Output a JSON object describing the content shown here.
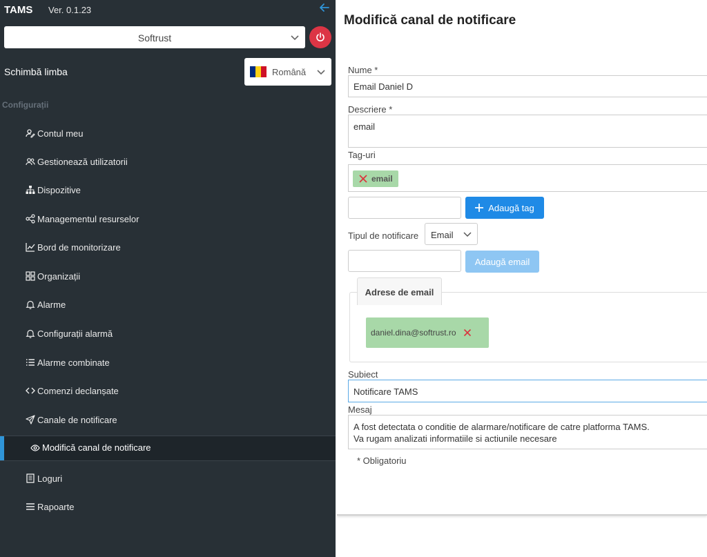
{
  "app": {
    "title": "TAMS",
    "version": "Ver. 0.1.23"
  },
  "sidebar": {
    "org_select": "Softrust",
    "language_label": "Schimbă limba",
    "language_value": "Română",
    "section": "Configurații",
    "items": [
      {
        "label": "Contul meu",
        "icon": "user-edit-icon"
      },
      {
        "label": "Gestionează utilizatorii",
        "icon": "users-icon"
      },
      {
        "label": "Dispozitive",
        "icon": "sitemap-icon"
      },
      {
        "label": "Managementul resurselor",
        "icon": "share-nodes-icon"
      },
      {
        "label": "Bord de monitorizare",
        "icon": "chart-line-icon"
      },
      {
        "label": "Organizații",
        "icon": "grid-icon"
      },
      {
        "label": "Alarme",
        "icon": "bell-icon"
      },
      {
        "label": "Configurații alarmă",
        "icon": "bell-icon"
      },
      {
        "label": "Alarme combinate",
        "icon": "list-icon"
      },
      {
        "label": "Comenzi declanșate",
        "icon": "code-icon"
      },
      {
        "label": "Canale de notificare",
        "icon": "send-icon"
      }
    ],
    "active_item": {
      "label": "Modifică canal de notificare",
      "icon": "eye-icon"
    },
    "bottom_items": [
      {
        "label": "Loguri",
        "icon": "book-icon"
      },
      {
        "label": "Rapoarte",
        "icon": "menu-icon"
      }
    ]
  },
  "form": {
    "title": "Modifică canal de notificare",
    "name_label": "Nume *",
    "name_value": "Email Daniel D",
    "description_label": "Descriere *",
    "description_value": "email",
    "tags_label": "Tag-uri",
    "tags": [
      "email"
    ],
    "add_tag_button": "Adaugă tag",
    "notification_type_label": "Tipul de notificare",
    "notification_type_value": "Email",
    "add_email_button": "Adaugă email",
    "emails_tab_label": "Adrese de email",
    "emails": [
      "daniel.dina@softrust.ro"
    ],
    "subject_label": "Subiect",
    "subject_value": "Notificare TAMS",
    "message_label": "Mesaj",
    "message_lines": [
      "A fost detectata o conditie de alarmare/notificare de catre platforma TAMS.",
      "Va rugam analizati informatiile si actiunile necesare"
    ],
    "required_note": "* Obligatoriu"
  },
  "colors": {
    "sidebar_bg": "#283036",
    "accent": "#1f8ae6",
    "chip_green": "#a8d8a8",
    "danger": "#dc3545"
  }
}
